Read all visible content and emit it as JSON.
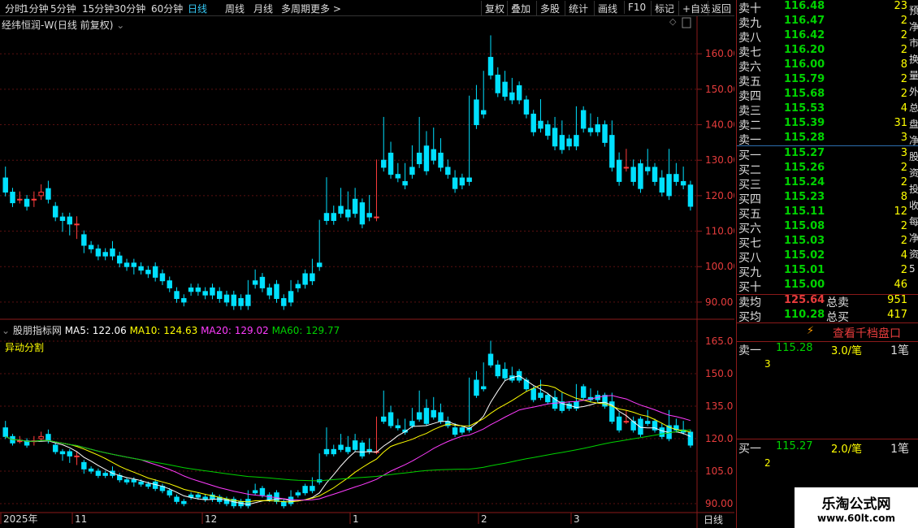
{
  "toolbar": {
    "left": [
      "分时",
      "1分钟",
      "5分钟",
      "15分钟",
      "30分钟",
      "60分钟",
      "日线",
      "周线",
      "月线",
      "多周期",
      "更多 >"
    ],
    "active": "日线",
    "right": [
      "复权",
      "叠加",
      "多股",
      "统计",
      "画线",
      "F10",
      "标记",
      "+自选",
      "返回"
    ]
  },
  "chart_title": "经纬恒润-W(日线 前复权)",
  "indicator": {
    "name": "股朋指标网",
    "ma": [
      {
        "label": "MA5: 122.06",
        "color": "#ffffff"
      },
      {
        "label": "MA10: 124.63",
        "color": "#ffff00"
      },
      {
        "label": "MA20: 129.02",
        "color": "#ff3cff"
      },
      {
        "label": "MA60: 129.77",
        "color": "#00d200"
      }
    ],
    "sublabel": "异动分割"
  },
  "axis_main": [
    "160.00",
    "150.00",
    "140.00",
    "130.00",
    "120.00",
    "110.00",
    "100.00",
    "90.00"
  ],
  "axis_sub": [
    "165.0",
    "150.0",
    "135.0",
    "120.0",
    "105.0",
    "90.00"
  ],
  "x_labels": [
    "2025年",
    "11",
    "12",
    "1",
    "2",
    "3"
  ],
  "period_label": "日线",
  "orderbook": {
    "asks": [
      {
        "n": "卖十",
        "p": "116.48",
        "v": "23"
      },
      {
        "n": "卖九",
        "p": "116.47",
        "v": "2"
      },
      {
        "n": "卖八",
        "p": "116.42",
        "v": "2"
      },
      {
        "n": "卖七",
        "p": "116.20",
        "v": "2"
      },
      {
        "n": "卖六",
        "p": "116.00",
        "v": "8"
      },
      {
        "n": "卖五",
        "p": "115.79",
        "v": "2"
      },
      {
        "n": "卖四",
        "p": "115.68",
        "v": "2"
      },
      {
        "n": "卖三",
        "p": "115.53",
        "v": "4"
      },
      {
        "n": "卖二",
        "p": "115.39",
        "v": "31"
      },
      {
        "n": "卖一",
        "p": "115.28",
        "v": "3"
      }
    ],
    "bids": [
      {
        "n": "买一",
        "p": "115.27",
        "v": "3"
      },
      {
        "n": "买二",
        "p": "115.26",
        "v": "2"
      },
      {
        "n": "买三",
        "p": "115.24",
        "v": "2"
      },
      {
        "n": "买四",
        "p": "115.23",
        "v": "8"
      },
      {
        "n": "买五",
        "p": "115.11",
        "v": "12"
      },
      {
        "n": "买六",
        "p": "115.08",
        "v": "2"
      },
      {
        "n": "买七",
        "p": "115.03",
        "v": "2"
      },
      {
        "n": "买八",
        "p": "115.02",
        "v": "4"
      },
      {
        "n": "买九",
        "p": "115.01",
        "v": "2"
      },
      {
        "n": "买十",
        "p": "115.00",
        "v": "46"
      }
    ],
    "sell_avg": {
      "label": "卖均",
      "price": "125.64",
      "total_label": "总卖",
      "total": "951"
    },
    "buy_avg": {
      "label": "买均",
      "price": "110.28",
      "total_label": "总买",
      "total": "417"
    },
    "thousand_btn": "查看千档盘口",
    "ask_detail": {
      "label": "卖一",
      "price": "115.28",
      "qty": "3.0/笔",
      "count": "1笔",
      "sub": "3"
    },
    "bid_detail": {
      "label": "买一",
      "price": "115.27",
      "qty": "2.0/笔",
      "count": "1笔",
      "sub": "2"
    }
  },
  "side_text": [
    "预",
    "净",
    "市",
    "换",
    "量",
    "外",
    "总",
    "盘",
    "净",
    "股",
    "资",
    "投",
    "收",
    "每",
    "净",
    "资",
    "5"
  ],
  "watermark": {
    "line1": "乐淘公式网",
    "line2": "www.60lt.com"
  },
  "chart_data": {
    "type": "candlestick",
    "y_range_main": [
      87,
      166
    ],
    "y_range_sub": [
      87,
      168
    ],
    "ohlc": [
      [
        125,
        127,
        122,
        121
      ],
      [
        121,
        120,
        119,
        118
      ],
      [
        119,
        120,
        119,
        119
      ],
      [
        119,
        118,
        118,
        117
      ],
      [
        119,
        120,
        118,
        119
      ],
      [
        120,
        122,
        120,
        121
      ],
      [
        122,
        123,
        120,
        119
      ],
      [
        117,
        116,
        114,
        114
      ],
      [
        114,
        113,
        111,
        113
      ],
      [
        114,
        113,
        110,
        112
      ],
      [
        112,
        113,
        109,
        112
      ],
      [
        109,
        106,
        105,
        106
      ],
      [
        106,
        106,
        105,
        105
      ],
      [
        105,
        104,
        104,
        103
      ],
      [
        104,
        104,
        103,
        103
      ],
      [
        105,
        106,
        103,
        103
      ],
      [
        103,
        103,
        101,
        101
      ],
      [
        101,
        101,
        100,
        100
      ],
      [
        101,
        100,
        99,
        100
      ],
      [
        100,
        100,
        99,
        99
      ],
      [
        99,
        99,
        99,
        98
      ],
      [
        100,
        98,
        98,
        97
      ],
      [
        98,
        97,
        97,
        96
      ],
      [
        96,
        95,
        94,
        94
      ],
      [
        93,
        92,
        91,
        91
      ],
      [
        91,
        91,
        90,
        90
      ],
      [
        94,
        94,
        93,
        93
      ],
      [
        94,
        94,
        93,
        93
      ],
      [
        93,
        93,
        92,
        92
      ],
      [
        94,
        94,
        92,
        92
      ],
      [
        93,
        93,
        92,
        91
      ],
      [
        92,
        92,
        90,
        90
      ],
      [
        92,
        91,
        91,
        89
      ],
      [
        91,
        91,
        89,
        89
      ],
      [
        92,
        95,
        91,
        89
      ],
      [
        96,
        98,
        95,
        95
      ],
      [
        97,
        96,
        94,
        94
      ],
      [
        94,
        93,
        92,
        92
      ],
      [
        95,
        92,
        91,
        91
      ],
      [
        91,
        91,
        89,
        89
      ],
      [
        93,
        95,
        93,
        90
      ],
      [
        95,
        95,
        94,
        94
      ],
      [
        98,
        98,
        95,
        95
      ],
      [
        98,
        101,
        97,
        96
      ],
      [
        101,
        112,
        100,
        100
      ],
      [
        115,
        124,
        113,
        113
      ],
      [
        115,
        116,
        113,
        113
      ],
      [
        117,
        121,
        115,
        115
      ],
      [
        116,
        120,
        114,
        114
      ],
      [
        119,
        121,
        115,
        115
      ],
      [
        118,
        116,
        115,
        112
      ],
      [
        115,
        119,
        114,
        114
      ],
      [
        114,
        129,
        114,
        114
      ],
      [
        130,
        141,
        128,
        128
      ],
      [
        132,
        134,
        127,
        126
      ],
      [
        126,
        128,
        125,
        125
      ],
      [
        124,
        128,
        123,
        123
      ],
      [
        128,
        133,
        126,
        126
      ],
      [
        132,
        141,
        129,
        129
      ],
      [
        134,
        137,
        127,
        127
      ],
      [
        133,
        138,
        130,
        130
      ],
      [
        132,
        135,
        128,
        128
      ],
      [
        128,
        129,
        126,
        126
      ],
      [
        125,
        126,
        122,
        122
      ],
      [
        125,
        125,
        124,
        123
      ],
      [
        125,
        147,
        124,
        124
      ],
      [
        147,
        150,
        140,
        140
      ],
      [
        144,
        154,
        143,
        143
      ],
      [
        159,
        164,
        154,
        154
      ],
      [
        154,
        155,
        149,
        149
      ],
      [
        152,
        154,
        148,
        148
      ],
      [
        149,
        152,
        147,
        147
      ],
      [
        151,
        151,
        147,
        147
      ],
      [
        147,
        146,
        143,
        143
      ],
      [
        143,
        142,
        138,
        138
      ],
      [
        141,
        146,
        139,
        139
      ],
      [
        140,
        140,
        138,
        137
      ],
      [
        139,
        141,
        134,
        134
      ],
      [
        137,
        140,
        133,
        133
      ],
      [
        136,
        136,
        134,
        134
      ],
      [
        137,
        144,
        134,
        134
      ],
      [
        144,
        144,
        139,
        139
      ],
      [
        139,
        142,
        138,
        138
      ],
      [
        140,
        141,
        138,
        138
      ],
      [
        140,
        140,
        135,
        135
      ],
      [
        137,
        140,
        128,
        128
      ],
      [
        130,
        131,
        124,
        124
      ],
      [
        128,
        132,
        128,
        128
      ],
      [
        128,
        129,
        124,
        124
      ],
      [
        129,
        129,
        122,
        122
      ],
      [
        128,
        132,
        127,
        127
      ],
      [
        128,
        128,
        124,
        124
      ],
      [
        125,
        126,
        121,
        121
      ],
      [
        126,
        132,
        120,
        120
      ],
      [
        126,
        128,
        124,
        124
      ],
      [
        124,
        127,
        123,
        123
      ],
      [
        123,
        121,
        117,
        117
      ]
    ],
    "ma": {
      "MA5": "122.06",
      "MA10": "124.63",
      "MA20": "129.02",
      "MA60": "129.77"
    }
  }
}
